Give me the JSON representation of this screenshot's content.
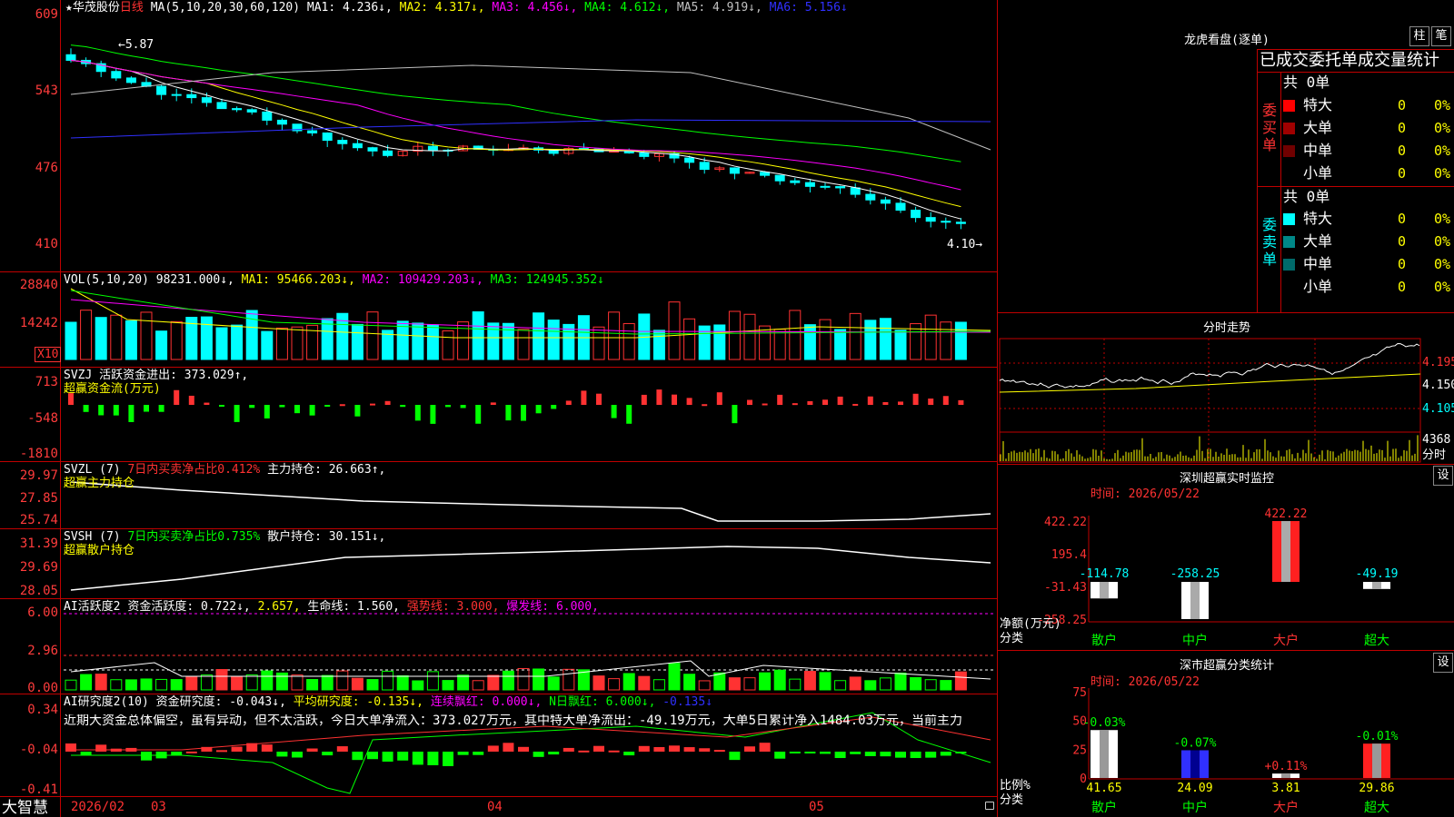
{
  "colors": {
    "up": "#ff3232",
    "down": "#00ffff",
    "ma1": "#ffffff",
    "ma2": "#ffff00",
    "ma3": "#ff00ff",
    "ma4": "#00ff00",
    "ma5": "#c0c0c0",
    "ma6": "#3030ff",
    "frame": "#c00000"
  },
  "kline": {
    "star": "★",
    "stock": "华茂股份",
    "period": "日线",
    "ma_label": "MA(5,10,20,30,60,120)",
    "ma1": "MA1: 4.236↓,",
    "ma2": "MA2: 4.317↓,",
    "ma3": "MA3: 4.456↓,",
    "ma4": "MA4: 4.612↓,",
    "ma5": "MA5: 4.919↓,",
    "ma6": "MA6: 5.156↓",
    "y_labels": [
      "609",
      "543",
      "476",
      "410"
    ],
    "high_mark": "←5.87",
    "low_mark": "4.10→"
  },
  "vol": {
    "label": "VOL(5,10,20)",
    "value": "98231.000↓,",
    "ma1": "MA1: 95466.203↓,",
    "ma2": "MA2: 109429.203↓,",
    "ma3": "MA3: 124945.352↓",
    "y_labels": [
      "28840",
      "14242"
    ],
    "unit": "X10"
  },
  "svzj": {
    "name": "SVZJ",
    "line1": "活跃资金进出: 373.029↑,",
    "line2": "超赢资金流(万元)",
    "y_labels": [
      "713",
      "-548",
      "-1810"
    ]
  },
  "svzl": {
    "name": "SVZL (7)",
    "pct": "7日内买卖净占比0.412%",
    "hold": "主力持仓: 26.663↑,",
    "line2": "超赢主力持仓",
    "y_labels": [
      "29.97",
      "27.85",
      "25.74"
    ]
  },
  "svsh": {
    "name": "SVSH (7)",
    "pct": "7日内买卖净占比0.735%",
    "hold": "散户持仓: 30.151↓,",
    "line2": "超赢散户持仓",
    "y_labels": [
      "31.39",
      "29.69",
      "28.05"
    ]
  },
  "ai1": {
    "name": "AI活跃度2",
    "a": "资金活跃度: 0.722↓,",
    "b": "2.657,",
    "c": "生命线: 1.560,",
    "d": "强势线: 3.000,",
    "e": "爆发线: 6.000,",
    "y_labels": [
      "6.00",
      "2.96",
      "0.00"
    ]
  },
  "ai2": {
    "name": "AI研究度2(10)",
    "a": "资金研究度: -0.043↓,",
    "b": "平均研究度: -0.135↓,",
    "c": "连续飘红: 0.000↓,",
    "d": "N日飘红: 6.000↓,",
    "e": "-0.135↓",
    "desc": "近期大资金总体偏空，虽有异动，但不太活跃，今日大单净流入：373.027万元，其中特大单净流出：-49.19万元，大单5日累计净入1484.03万元，当前主力",
    "y_labels": [
      "0.34",
      "-0.04",
      "-0.41"
    ]
  },
  "bottom": {
    "brand": "大智慧",
    "date": "2026/02",
    "m3": "03",
    "m4": "04",
    "m5": "05"
  },
  "lhb": {
    "title": "龙虎看盘(逐单)",
    "btn1": "柱",
    "btn2": "笔",
    "header": "已成交委托单成交量统计",
    "buy": {
      "label": "委买单",
      "count": "共 0单",
      "rows": [
        {
          "name": "特大",
          "v": "0",
          "p": "0%",
          "c": "#ff0000"
        },
        {
          "name": "大单",
          "v": "0",
          "p": "0%",
          "c": "#a00000"
        },
        {
          "name": "中单",
          "v": "0",
          "p": "0%",
          "c": "#700000"
        },
        {
          "name": "小单",
          "v": "0",
          "p": "0%",
          "c": ""
        }
      ]
    },
    "sell": {
      "label": "委卖单",
      "count": "共 0单",
      "rows": [
        {
          "name": "特大",
          "v": "0",
          "p": "0%",
          "c": "#00ffff"
        },
        {
          "name": "大单",
          "v": "0",
          "p": "0%",
          "c": "#008888"
        },
        {
          "name": "中单",
          "v": "0",
          "p": "0%",
          "c": "#006a6a"
        },
        {
          "name": "小单",
          "v": "0",
          "p": "0%",
          "c": ""
        }
      ]
    }
  },
  "fs": {
    "title": "分时走势",
    "p1": "4.195",
    "p2": "4.150",
    "p3": "4.105",
    "vol": "4368",
    "unit": "分时"
  },
  "sz": {
    "title": "深圳超赢实时监控",
    "btn": "设",
    "time": "时间: 2026/05/22",
    "y_labels": [
      "422.22",
      "195.4",
      "-31.43",
      "-258.25"
    ],
    "ylab1": "净额(万元)",
    "ylab2": "分类",
    "bars": [
      {
        "name": "散户",
        "v": -114.78,
        "label": "-114.78"
      },
      {
        "name": "中户",
        "v": -258.25,
        "label": "-258.25"
      },
      {
        "name": "大户",
        "v": 422.22,
        "label": "422.22"
      },
      {
        "name": "超大",
        "v": -49.19,
        "label": "-49.19"
      }
    ]
  },
  "fl": {
    "title": "深市超赢分类统计",
    "btn": "设",
    "time": "时间: 2026/05/22",
    "y_labels": [
      "75",
      "50",
      "25",
      "0"
    ],
    "ylab1": "比例%",
    "ylab2": "分类",
    "bars": [
      {
        "name": "散户",
        "v": 41.65,
        "label": "41.65",
        "chg": "-0.03%"
      },
      {
        "name": "中户",
        "v": 24.09,
        "label": "24.09",
        "chg": "-0.07%"
      },
      {
        "name": "大户",
        "v": 3.81,
        "label": "3.81",
        "chg": "+0.11%"
      },
      {
        "name": "超大",
        "v": 29.86,
        "label": "29.86",
        "chg": "-0.01%"
      }
    ]
  }
}
